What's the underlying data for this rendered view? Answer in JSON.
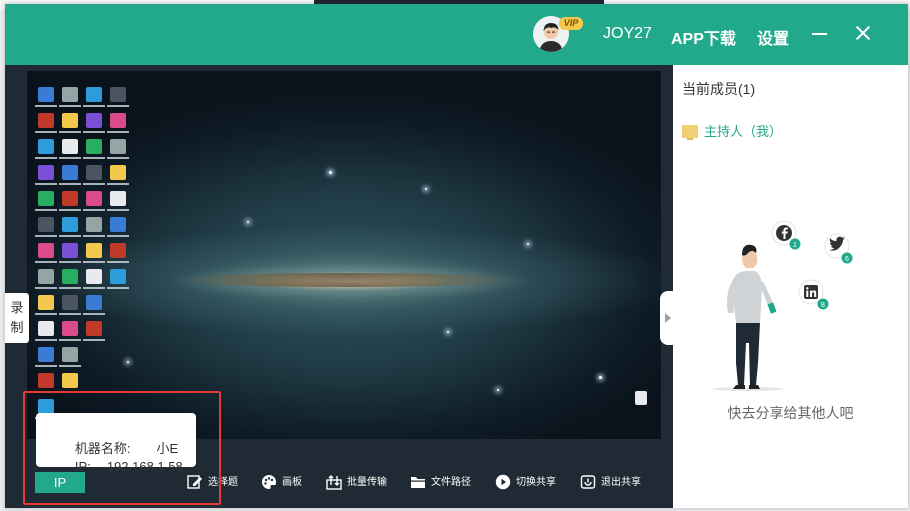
{
  "titlebar": {
    "vip_badge": "VIP",
    "user_name": "JOY27",
    "app_download": "APP下载",
    "settings": "设置",
    "minimize_icon": "minimize-icon",
    "close_icon": "close-icon"
  },
  "record_tab": {
    "chars": [
      "录",
      "制"
    ]
  },
  "ip_popup": {
    "machine_label": "机器名称:",
    "machine_value": "小E",
    "ip_label": "IP:",
    "ip_value": "192.168.1.58"
  },
  "toolbar": {
    "ip_button": "IP",
    "tools": [
      {
        "label": "选择题",
        "icon": "edit-icon"
      },
      {
        "label": "画板",
        "icon": "palette-icon"
      },
      {
        "label": "批量传输",
        "icon": "transfer-icon"
      },
      {
        "label": "文件路径",
        "icon": "folder-icon"
      },
      {
        "label": "切换共享",
        "icon": "switch-icon"
      },
      {
        "label": "退出共享",
        "icon": "exit-icon"
      }
    ]
  },
  "side_panel": {
    "members_title": "当前成员(1)",
    "host_label": "主持人（我）",
    "social_badges": {
      "facebook": "1",
      "twitter": "6",
      "linkedin": "8"
    },
    "share_prompt": "快去分享给其他人吧"
  },
  "colors": {
    "brand_green": "#22a98b",
    "toolbar_bg": "#1f2a35",
    "highlight_red": "#e53935"
  }
}
